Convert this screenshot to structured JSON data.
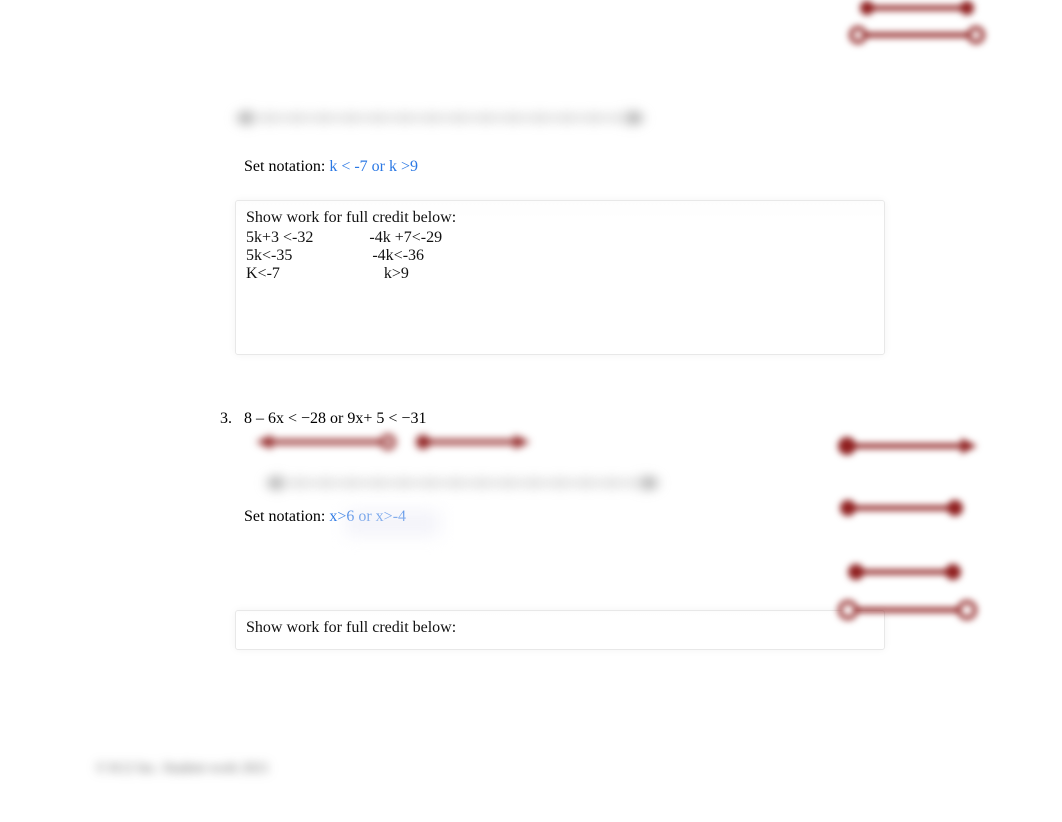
{
  "q2": {
    "set_label": "Set notation:  ",
    "set_answer": "k < -7 or    k >9",
    "work_prompt": "Show work for full credit below:",
    "work_lines": [
      "5k+3 <-32              -4k +7<-29",
      "5k<-35                    -4k<-36",
      "K<-7                          k>9"
    ]
  },
  "q3": {
    "number": "3.",
    "problem": "8 – 6x < −28 or 9x+ 5 < −31",
    "set_label": "Set notation:  ",
    "set_answer": "x>6   or   x>-4",
    "work_prompt": "Show work for full credit below:"
  },
  "footer": "© K12 Inc. Student work 2021"
}
